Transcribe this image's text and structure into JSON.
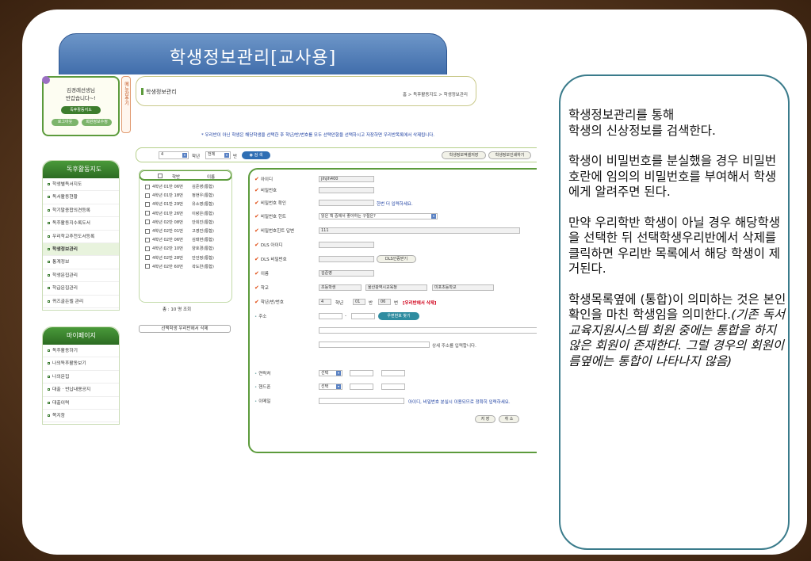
{
  "slide_title": "학생정보관리[교사용]",
  "user_panel": {
    "greeting_name": "김경례선생님",
    "greeting_sub": "반갑습니다~!",
    "site_button": "독후활동지도",
    "logout_button": "로그아웃",
    "edit_button": "회원정보수정",
    "menu_tab": "메뉴감추기"
  },
  "header": {
    "page_title": "학생정보관리",
    "breadcrumb": "홈 > 독후활동지도 > 학생정보관리",
    "notice": "* 우리반이 아닌 학생은 해당학생을 선택한 후 학년/반/번호를 모두 선택안함을 선택하시고 저장하면 우리반목록에서 삭제됩니다."
  },
  "search_bar": {
    "grade_value": "4",
    "grade_suffix": "학년",
    "class_value": "전체",
    "class_suffix": "반",
    "search_button": "검 색",
    "save_info_button": "학생정보엑셀저장",
    "print_info_button": "학생정보인쇄하기"
  },
  "sidebar1": {
    "title": "독후활동지도",
    "items": [
      "학생별독서지도",
      "독서활동현황",
      "학기말종합의견등록",
      "독후활동지수록도서",
      "우리학교추천도서등록",
      "학생정보관리",
      "통계정보",
      "학생문집관리",
      "학급문집관리",
      "퀴즈골든벨 관리"
    ]
  },
  "sidebar2": {
    "title": "마이페이지",
    "items": [
      "독후활동하기",
      "나의독후활동보기",
      "나의문집",
      "대출 · 반납내용공지",
      "대출이력",
      "쪽지함"
    ]
  },
  "student_list": {
    "col_class": "학반",
    "col_name": "이름",
    "rows": [
      {
        "class": "4학년 01반 06번",
        "name": "김준영(통합)"
      },
      {
        "class": "4학년 01반 18번",
        "name": "정현우(통합)"
      },
      {
        "class": "4학년 01반 29번",
        "name": "유소영(통합)"
      },
      {
        "class": "4학년 01반 26번",
        "name": "이랑은(통합)"
      },
      {
        "class": "4학년 02반 08번",
        "name": "안희진(통합)"
      },
      {
        "class": "4학년 02반 01번",
        "name": "고영진(통합)"
      },
      {
        "class": "4학년 02반 06번",
        "name": "김태현(통합)"
      },
      {
        "class": "4학년 02반 10번",
        "name": "양호경(통합)"
      },
      {
        "class": "4학년 02반 28번",
        "name": "안언정(통합)"
      },
      {
        "class": "4학년 02반 60번",
        "name": "곽도완(통합)"
      }
    ],
    "total": "총 : 10 명 조회",
    "delete_button": "선택학생 우리반에서 삭제"
  },
  "form": {
    "fields": [
      {
        "label": "아이디",
        "value": "jihjih400",
        "required": true
      },
      {
        "label": "비밀번호",
        "value": "",
        "required": true
      },
      {
        "label": "비밀번호 확인",
        "value": "",
        "note": "한번 더 입력하세요.",
        "required": true
      },
      {
        "label": "비밀번호 힌트",
        "value": "읽은 책 중에서 좋아하는 구절은?",
        "required": true
      },
      {
        "label": "비밀번호힌트 답변",
        "value": "111",
        "required": true
      },
      {
        "label": "DLS 아이디",
        "value": "",
        "required": true
      },
      {
        "label": "DLS 비밀번호",
        "value": "",
        "button": "DLS인증받기",
        "required": true
      },
      {
        "label": "이름",
        "value": "김준영",
        "required": true
      },
      {
        "label": "학교",
        "value": "초등학생",
        "value2": "울산광역시교육청",
        "value3": "미포초등학교",
        "required": true
      },
      {
        "label": "학년/반/번호",
        "grade": "4",
        "grade_unit": "학년",
        "class": "01",
        "class_unit": "반",
        "number": "06",
        "number_unit": "번",
        "warn": "[우리반에서 삭제]",
        "required": true
      },
      {
        "label": "주소",
        "required": false,
        "zip_button": "우편번호 찾기",
        "addr_note": "상세 주소를 입력합니다."
      },
      {
        "label": "연락처",
        "select": "선택",
        "required": false
      },
      {
        "label": "핸드폰",
        "select": "선택",
        "required": false
      },
      {
        "label": "이메일",
        "note": "아이디, 비밀번호 분실시 이용되므로 정확히 입력하세요.",
        "required": false
      }
    ],
    "save_button": "저 장",
    "cancel_button": "취 소"
  },
  "notes": {
    "p1a": "학생정보관리를 통해",
    "p1b": "학생의 신상정보를 검색한다.",
    "p2": "학생이 비밀번호를 분실했을 경우 비밀번호란에 임의의 비밀번호를 부여해서 학생에게 알려주면 된다.",
    "p3": "만약 우리학반 학생이 아닐 경우 해당학생을 선택한 뒤 선택학생우리반에서 삭제를 클릭하면 우리반 목록에서 해당 학생이 제거된다.",
    "p4": "학생목록옆에 (통합)이 의미하는 것은 본인확인을 마친 학생임을 의미한다.",
    "p4_italic": "(기존 독서교육지원시스템 회원 중에는 통합을 하지 않은 회원이 존재한다. 그럴 경우의 회원이름옆에는 통합이 나타나지 않음)"
  }
}
